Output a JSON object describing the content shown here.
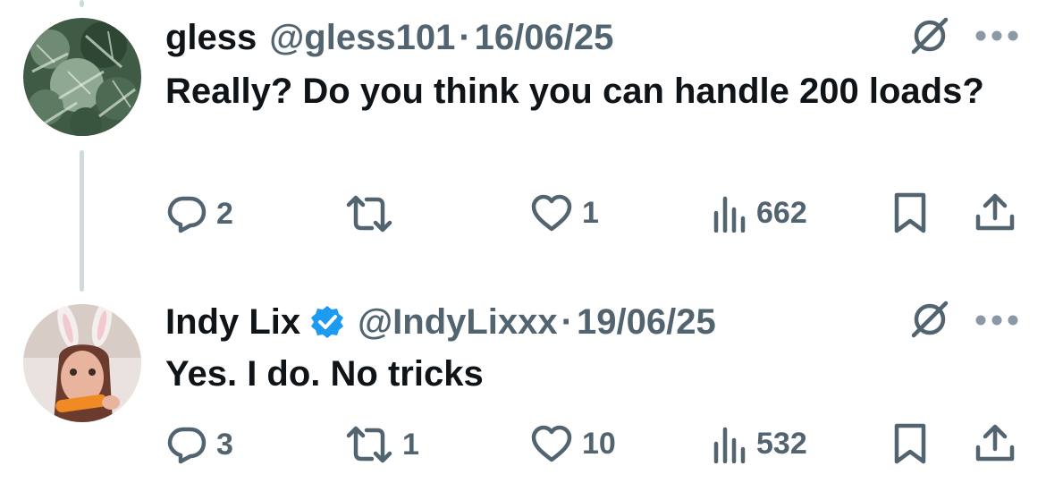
{
  "tweets": [
    {
      "name": "gless",
      "handle": "@gless101",
      "separator": "·",
      "date": "16/06/25",
      "verified": false,
      "text": "Really? Do you think you can handle 200 loads?",
      "avatar_icon": "avatar-plant",
      "stats": {
        "replies": "2",
        "reposts": "",
        "likes": "1",
        "views": "662"
      }
    },
    {
      "name": "Indy Lix",
      "handle": "@IndyLixxx",
      "separator": "·",
      "date": "19/06/25",
      "verified": true,
      "text": "Yes. I do. No tricks",
      "avatar_icon": "avatar-person-bunny-ears",
      "stats": {
        "replies": "3",
        "reposts": "1",
        "likes": "10",
        "views": "532"
      }
    }
  ],
  "icons": {
    "reply": "reply-icon",
    "repost": "repost-icon",
    "like": "like-icon",
    "views": "views-icon",
    "bookmark": "bookmark-icon",
    "share": "share-icon",
    "grok": "grok-icon",
    "more": "more-icon",
    "verified": "verified-badge-icon"
  },
  "colors": {
    "text": "#0f1419",
    "secondary": "#536471",
    "thread_line": "#cfd9de",
    "verified": "#1d9bf0"
  }
}
